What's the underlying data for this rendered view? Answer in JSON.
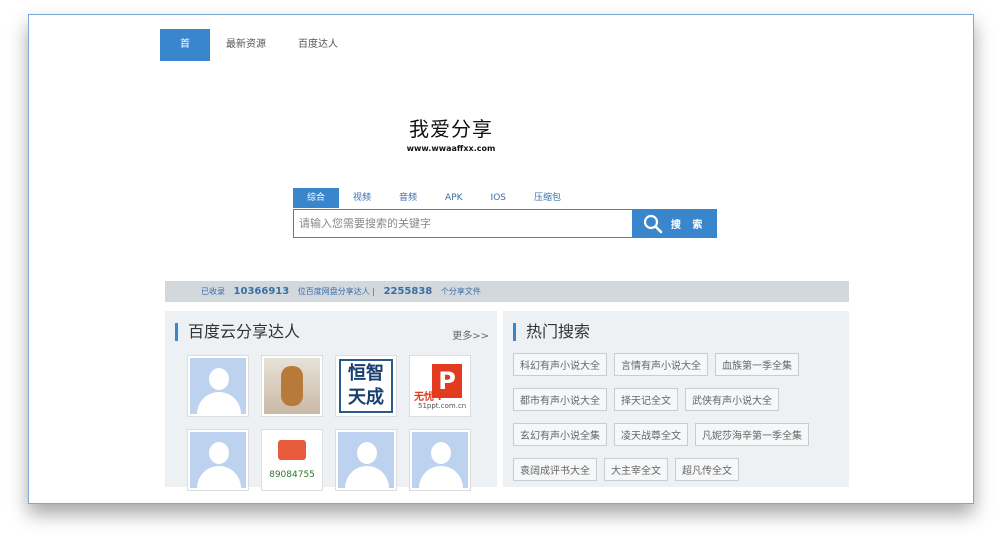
{
  "nav": [
    {
      "label": "首页",
      "active": true
    },
    {
      "label": "最新资源",
      "active": false
    },
    {
      "label": "百度达人",
      "active": false
    }
  ],
  "logo": {
    "title": "我爱分享",
    "url": "www.wwaaffxx.com"
  },
  "search": {
    "tabs": [
      "综合",
      "视频",
      "音频",
      "APK",
      "IOS",
      "压缩包"
    ],
    "active_tab": "综合",
    "placeholder": "请输入您需要搜索的关键字",
    "button": "搜 索"
  },
  "stats": {
    "prefix": "已收录",
    "users": "10366913",
    "users_label": "位百度网盘分享达人 |",
    "files": "2255838",
    "files_label": "个分享文件"
  },
  "experts": {
    "title": "百度云分享达人",
    "more": "更多>>",
    "avatars": [
      {
        "type": "default-avatar-icon"
      },
      {
        "type": "toy-photo"
      },
      {
        "type": "text",
        "text": "恒智天成"
      },
      {
        "type": "logo",
        "text": "P",
        "caption": "无忧·P",
        "url": "51ppt.com.cn"
      },
      {
        "type": "default-avatar-icon"
      },
      {
        "type": "qq",
        "text": "89084755"
      },
      {
        "type": "default-avatar-icon"
      },
      {
        "type": "default-avatar-icon"
      }
    ]
  },
  "hot": {
    "title": "热门搜索",
    "tags": [
      "科幻有声小说大全",
      "言情有声小说大全",
      "血族第一季全集",
      "都市有声小说大全",
      "择天记全文",
      "武侠有声小说大全",
      "玄幻有声小说全集",
      "凌天战尊全文",
      "凡妮莎海辛第一季全集",
      "袁阔成评书大全",
      "大主宰全文",
      "超凡传全文"
    ]
  },
  "colors": {
    "accent": "#3a86cd",
    "panel": "#eef1f4",
    "stats_bar": "#d3d8dd"
  }
}
